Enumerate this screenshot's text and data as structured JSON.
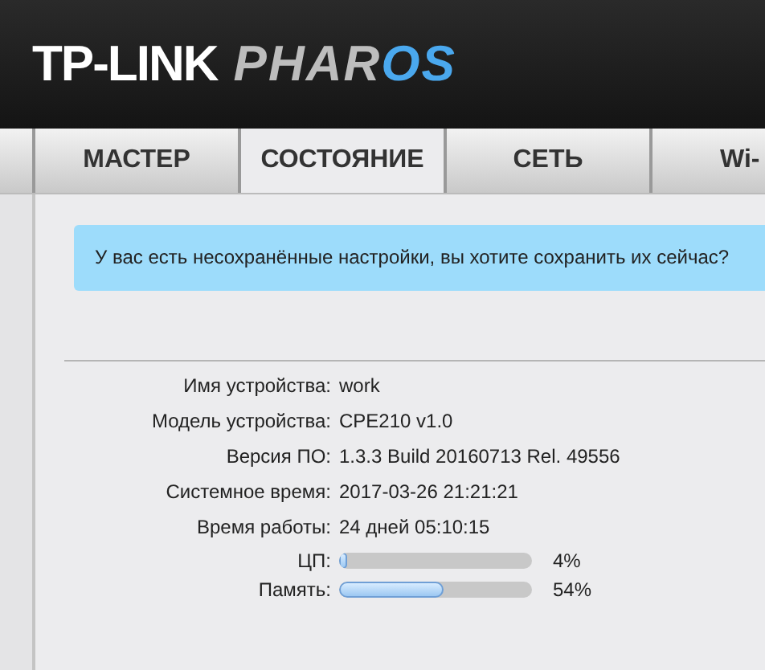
{
  "header": {
    "brand": "TP-LINK",
    "product": "PHAR",
    "product_accent": "OS"
  },
  "tabs": [
    {
      "label": "МАСТЕР",
      "selected": false
    },
    {
      "label": "СОСТОЯНИЕ",
      "selected": true
    },
    {
      "label": "СЕТЬ",
      "selected": false
    },
    {
      "label": "Wi-",
      "selected": false
    }
  ],
  "notice": "У вас есть несохранённые настройки, вы хотите сохранить их сейчас?",
  "info": [
    {
      "label": "Имя устройства:",
      "value": "work"
    },
    {
      "label": "Модель устройства:",
      "value": "CPE210 v1.0"
    },
    {
      "label": "Версия ПО:",
      "value": "1.3.3 Build 20160713 Rel. 49556"
    },
    {
      "label": "Системное время:",
      "value": "2017-03-26 21:21:21"
    },
    {
      "label": "Время работы:",
      "value": "24 дней 05:10:15"
    }
  ],
  "meters": [
    {
      "label": "ЦП:",
      "level": 0.04,
      "reading": "4%"
    },
    {
      "label": "Память:",
      "level": 0.54,
      "reading": "54%"
    }
  ]
}
